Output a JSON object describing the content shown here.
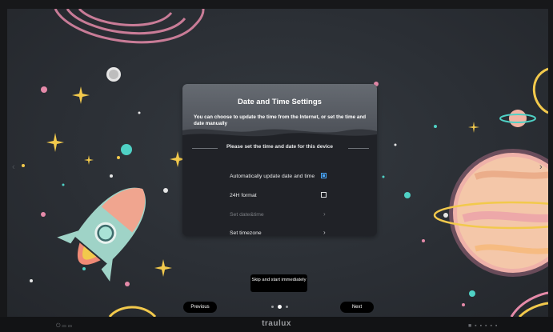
{
  "dialog": {
    "title": "Date and Time Settings",
    "description": "You can choose to update the time from the Internet, or set the time and date manually",
    "section_label": "Please set the time and date for this device",
    "options": [
      {
        "label": "Automatically update date and time",
        "control": "checkbox",
        "checked": true,
        "enabled": true
      },
      {
        "label": "24H format",
        "control": "checkbox",
        "checked": false,
        "enabled": true
      },
      {
        "label": "Set date&time",
        "control": "chevron",
        "enabled": false
      },
      {
        "label": "Set timezone",
        "control": "chevron",
        "enabled": true
      }
    ]
  },
  "footer": {
    "skip_label": "Skip and start immediately",
    "previous_label": "Previous",
    "next_label": "Next",
    "page_indicator": {
      "total": 3,
      "active": 2
    }
  },
  "device": {
    "brand": "traulux"
  },
  "icons": {
    "chevron": "chevron-right-icon",
    "checkbox": "checkbox-icon",
    "rocket": "rocket-illustration",
    "planet": "planet-illustration"
  },
  "colors": {
    "accent": "#4aa8ff",
    "dialog_bg": "#202227",
    "header_bg": "#5b6067",
    "screen_bg": "#2b2f35"
  }
}
